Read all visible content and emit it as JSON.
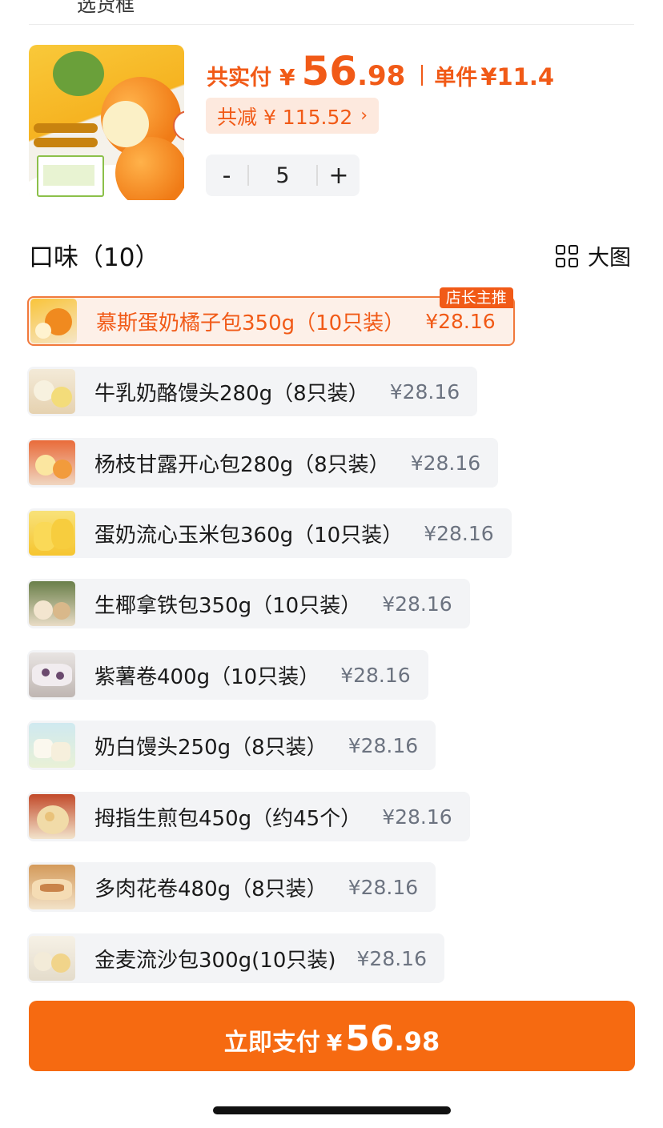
{
  "top": {
    "partial_text": "选货框"
  },
  "product": {
    "paid_label": "共实付",
    "yen": "¥",
    "paid_int": "56",
    "paid_dec": ".98",
    "unit_label": "单件",
    "unit_price": "¥11.4",
    "discount_text": "共减 ¥ 115.52",
    "discount_chevron": "›",
    "quantity": "5",
    "minus": "-",
    "plus": "+"
  },
  "flavors_section": {
    "title": "口味（10）",
    "big_view_label": "大图"
  },
  "flavors": [
    {
      "name": "慕斯蛋奶橘子包350g（10只装）",
      "price": "¥28.16",
      "badge": "店长主推",
      "selected": true
    },
    {
      "name": "牛乳奶酪馒头280g（8只装）",
      "price": "¥28.16"
    },
    {
      "name": "杨枝甘露开心包280g（8只装）",
      "price": "¥28.16"
    },
    {
      "name": "蛋奶流心玉米包360g（10只装）",
      "price": "¥28.16"
    },
    {
      "name": "生椰拿铁包350g（10只装）",
      "price": "¥28.16"
    },
    {
      "name": "紫薯卷400g（10只装）",
      "price": "¥28.16"
    },
    {
      "name": "奶白馒头250g（8只装）",
      "price": "¥28.16"
    },
    {
      "name": "拇指生煎包450g（约45个）",
      "price": "¥28.16"
    },
    {
      "name": "多肉花卷480g（8只装）",
      "price": "¥28.16"
    },
    {
      "name": "金麦流沙包300g(10只装)",
      "price": "¥28.16"
    }
  ],
  "pay": {
    "label": "立即支付",
    "yen": "¥",
    "int": "56",
    "dec": ".98"
  },
  "colors": {
    "accent": "#f15a17",
    "pay_button": "#f66a11",
    "chip_bg": "#f3f4f6",
    "selected_bg": "#fdf0e8"
  }
}
